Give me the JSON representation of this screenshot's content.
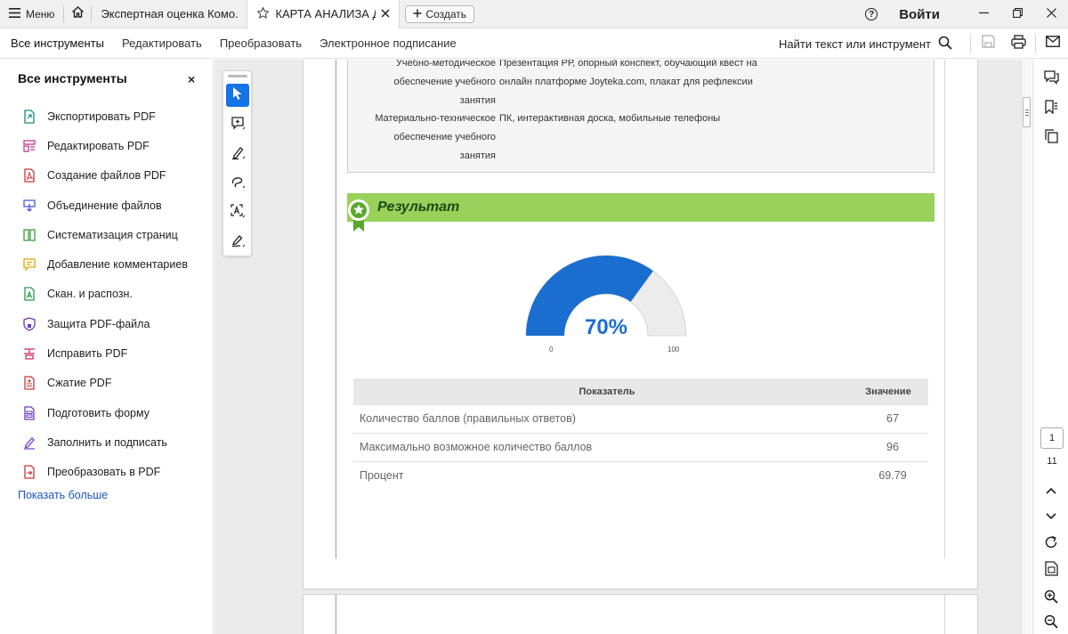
{
  "titlebar": {
    "menu_label": "Меню",
    "tab1_label": "Экспертная оценка  Комо...",
    "tab2_label": "КАРТА АНАЛИЗА  Д...",
    "create_label": "Создать",
    "login_label": "Войти",
    "icons": [
      "hamburger-icon",
      "home-icon",
      "star-icon",
      "close-icon",
      "plus-icon",
      "help-icon",
      "minimize-icon",
      "restore-icon",
      "window-close-icon"
    ]
  },
  "toolbar": {
    "tabs": [
      "Все инструменты",
      "Редактировать",
      "Преобразовать",
      "Электронное подписание"
    ],
    "search_label": "Найти текст или инструмент",
    "icons": [
      "search-icon",
      "save-icon",
      "print-icon",
      "mail-icon"
    ]
  },
  "left_panel": {
    "title": "Все инструменты",
    "close": "×",
    "tools": [
      {
        "label": "Экспортировать PDF",
        "icon": "export-pdf-icon",
        "color": "#1a8a83"
      },
      {
        "label": "Редактировать PDF",
        "icon": "edit-pdf-icon",
        "color": "#c8358e"
      },
      {
        "label": "Создание файлов PDF",
        "icon": "create-pdf-icon",
        "color": "#d0353a"
      },
      {
        "label": "Объединение файлов",
        "icon": "combine-files-icon",
        "color": "#4a5ad4"
      },
      {
        "label": "Систематизация страниц",
        "icon": "organize-pages-icon",
        "color": "#3a9a3a"
      },
      {
        "label": "Добавление комментариев",
        "icon": "comment-icon",
        "color": "#e0a800"
      },
      {
        "label": "Скан. и распозн.",
        "icon": "scan-icon",
        "color": "#2a9a4a"
      },
      {
        "label": "Защита PDF-файла",
        "icon": "protect-icon",
        "color": "#6a3ac8"
      },
      {
        "label": "Исправить PDF",
        "icon": "redact-icon",
        "color": "#d03060"
      },
      {
        "label": "Сжатие PDF",
        "icon": "compress-icon",
        "color": "#d0353a"
      },
      {
        "label": "Подготовить форму",
        "icon": "form-icon",
        "color": "#6a3ac8"
      },
      {
        "label": "Заполнить и подписать",
        "icon": "fill-sign-icon",
        "color": "#7a3ac8"
      },
      {
        "label": "Преобразовать в PDF",
        "icon": "convert-pdf-icon",
        "color": "#d0353a"
      }
    ],
    "show_more": "Показать больше"
  },
  "float_tools": [
    "select-icon",
    "add-comment-icon",
    "highlight-icon",
    "draw-icon",
    "text-recognition-icon",
    "sign-icon"
  ],
  "document": {
    "info_rows": [
      {
        "label_lines": [
          "Учебно-методическое",
          "обеспечение учебного",
          "занятия"
        ],
        "value_lines": [
          "Презентация РР, опорный конспект, обучающий квест на",
          "онлайн платформе Joyteka.com, плакат для рефлексии"
        ]
      },
      {
        "label_lines": [
          "Материально-техническое",
          "обеспечение учебного",
          "занятия"
        ],
        "value_lines": [
          "ПК, интерактивная доска, мобильные телефоны"
        ]
      }
    ],
    "result_title": "Результат",
    "gauge": {
      "value_text": "70%",
      "min": "0",
      "max": "100",
      "fraction": 0.7,
      "fill_color": "#1a6ed0",
      "track_color": "#ececec"
    },
    "table": {
      "headers": [
        "Показатель",
        "Значение"
      ],
      "rows": [
        {
          "label": "Количество баллов (правильных ответов)",
          "value": "67"
        },
        {
          "label": "Максимально возможное количество баллов",
          "value": "96"
        },
        {
          "label": "Процент",
          "value": "69.79"
        }
      ]
    }
  },
  "right_rail": {
    "icons": [
      "comments-panel-icon",
      "bookmark-icon",
      "copy-icon",
      "chevron-up-icon",
      "chevron-down-icon",
      "refresh-icon",
      "page-fit-icon",
      "zoom-in-icon",
      "zoom-out-icon"
    ],
    "current_page": "1",
    "total_pages": "11"
  },
  "colors": {
    "accent": "#1473e6",
    "result_banner": "#99d15b",
    "link": "#1a56c4"
  }
}
